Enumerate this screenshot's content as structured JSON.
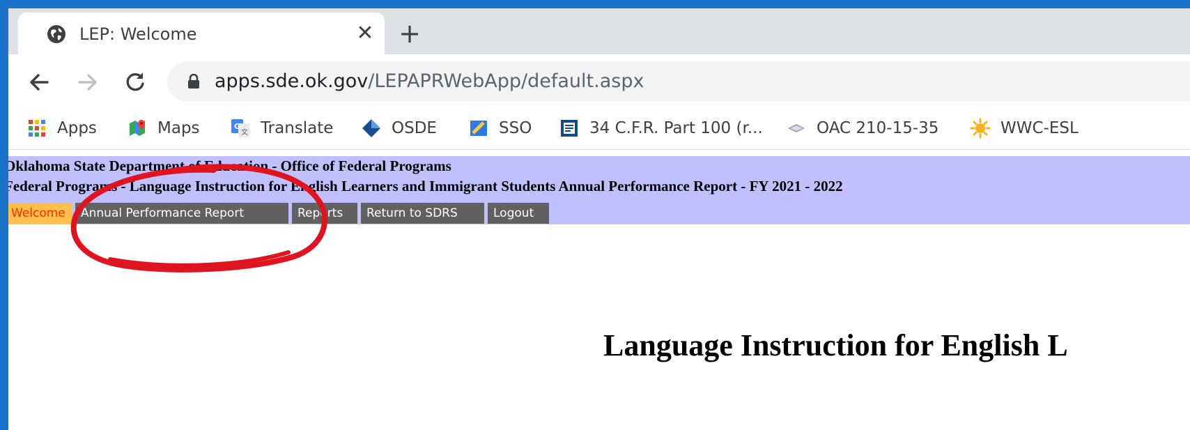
{
  "browser": {
    "tab": {
      "title": "LEP: Welcome",
      "close": "✕"
    },
    "new_tab": "+",
    "nav": {
      "back": "←",
      "forward": "→",
      "reload": "⟳"
    },
    "url": {
      "host": "apps.sde.ok.gov",
      "path": "/LEPAPRWebApp/default.aspx"
    },
    "bookmarks": [
      {
        "label": "Apps",
        "icon": "apps-grid-icon"
      },
      {
        "label": "Maps",
        "icon": "maps-icon"
      },
      {
        "label": "Translate",
        "icon": "translate-icon"
      },
      {
        "label": "OSDE",
        "icon": "osde-icon"
      },
      {
        "label": "SSO",
        "icon": "sso-icon"
      },
      {
        "label": "34 C.F.R. Part 100 (r...",
        "icon": "document-icon"
      },
      {
        "label": "OAC 210-15-35",
        "icon": "oac-icon"
      },
      {
        "label": "WWC-ESL",
        "icon": "sun-icon"
      }
    ]
  },
  "page": {
    "header_line1": "Oklahoma State Department of Education - Office of Federal Programs",
    "header_line2": "Federal Programs - Language Instruction for English Learners and Immigrant Students Annual Performance Report - FY 2021 - 2022",
    "menu": [
      {
        "label": "Welcome",
        "active": true
      },
      {
        "label": "Annual Performance Report"
      },
      {
        "label": "Reports"
      },
      {
        "label": "Return to SDRS"
      },
      {
        "label": "Logout"
      }
    ],
    "main_heading": "Language Instruction for English L"
  },
  "colors": {
    "header_bg": "#c0c0ff",
    "menu_bg": "#616161",
    "active_menu_bg": "#ffc04c",
    "active_menu_text": "#ff2a00",
    "annotation": "#e0141e",
    "window_border": "#1a73c9"
  }
}
